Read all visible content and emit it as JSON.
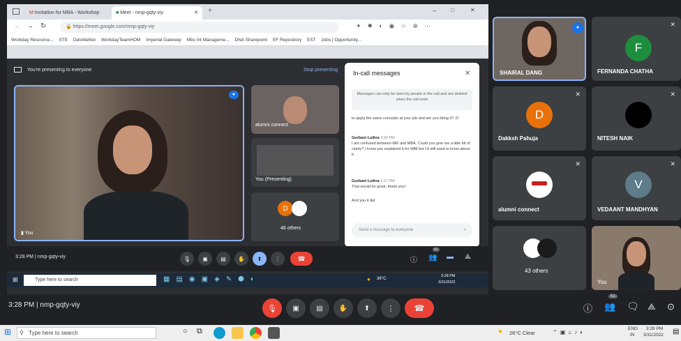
{
  "browser": {
    "tabs": [
      "Invitation for MBA - Workshop",
      "Meet - nmp-gqty-viy"
    ],
    "url": "https://meet.google.com/nmp-gqty-viy",
    "bookmarks": [
      "Workday Resource...",
      "STE",
      "DeloitteNet",
      "WorkdayTeamHOM",
      "Imperial Gateway",
      "Mbs Int Manageme...",
      "DNA Sharepoint",
      "EF Repository",
      "EST",
      "Jobs | Opportunity..."
    ]
  },
  "presenting": {
    "text": "You're presenting to everyone",
    "stop_label": "Stop presenting"
  },
  "inner_tiles": {
    "main_label": "You",
    "small1_label": "alumni connect",
    "small2_label": "You (Presenting)",
    "others_label": "48 others"
  },
  "chat": {
    "title": "In-call messages",
    "notice": "Messages can only be seen by people in the call and are deleted when the call ends",
    "messages": [
      {
        "author": "",
        "time": "",
        "text": "to apply the same concepts at your job and are you liking it? :D"
      },
      {
        "author": "Gurbani Luthra",
        "time": "3:26 PM",
        "text": "I am confused between MiF and MBA. Could you give me a little bit of clarity? I know you explained it for MiM but I'd still want to know about it."
      },
      {
        "author": "Gurbani Luthra",
        "time": "3:27 PM",
        "text": "That would be great. thank you!"
      },
      {
        "author": "",
        "time": "",
        "text": "And you it did"
      }
    ],
    "input_placeholder": "Send a message to everyone"
  },
  "inner_bar": {
    "time_code": "3:28 PM  |  nmp-gqty-viy",
    "badge": "51"
  },
  "inner_taskbar": {
    "search": "Type here to search",
    "weather": "36°C",
    "time": "3:28 PM",
    "date": "3/31/2022"
  },
  "participants": [
    {
      "name": "SHAIRAL DANG",
      "initial": ""
    },
    {
      "name": "FERNANDA CHATHA",
      "initial": "F",
      "color": "#1e8e3e"
    },
    {
      "name": "Dakksh Pahuja",
      "initial": "D",
      "color": "#e8710a"
    },
    {
      "name": "NITESH NAIK",
      "initial": ""
    },
    {
      "name": "alumni connect",
      "initial": ""
    },
    {
      "name": "VEDAANT MANDHYAN",
      "initial": "V",
      "color": "#5f7c8a"
    },
    {
      "name": "43 others",
      "initial": ""
    },
    {
      "name": "You",
      "initial": ""
    }
  ],
  "meet_bar": {
    "time_code": "3:28 PM  |  nmp-gqty-viy",
    "participant_badge": "51",
    "accent": "#ea4335"
  },
  "taskbar": {
    "search": "Type here to search",
    "weather": "26°C  Clear",
    "lang_top": "ENG",
    "lang_bottom": "IN",
    "time": "3:28 PM",
    "date": "3/31/2022"
  }
}
